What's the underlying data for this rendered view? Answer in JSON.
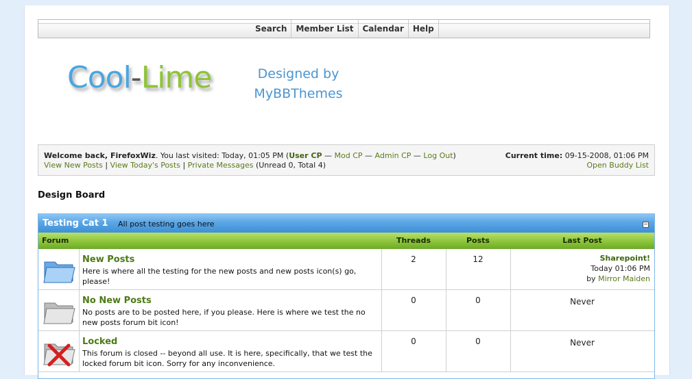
{
  "menu": {
    "items": [
      "Search",
      "Member List",
      "Calendar",
      "Help"
    ]
  },
  "logo": {
    "cool": "Cool",
    "dash": "-",
    "lime": "Lime"
  },
  "designed_by": {
    "line1": "Designed by",
    "line2": "MyBBThemes"
  },
  "welcome": {
    "greeting": "Welcome back, FirefoxWiz",
    "last_visit_prefix": ". You last visited: Today, 01:05 PM (",
    "user_cp": "User CP",
    "sep": " — ",
    "mod_cp": "Mod CP",
    "admin_cp": "Admin CP",
    "log_out": "Log Out",
    "close_paren": ")",
    "current_time_label": "Current time:",
    "current_time_value": " 09-15-2008, 01:06 PM",
    "view_new_posts": "View New Posts",
    "pipe": " | ",
    "view_todays_posts": "View Today's Posts",
    "private_messages": "Private Messages",
    "pm_counts": " (Unread 0, Total 4)",
    "open_buddy_list": "Open Buddy List"
  },
  "board_title": "Design Board",
  "category": {
    "title": "Testing Cat 1",
    "description": "All post testing goes here",
    "collapse": "−"
  },
  "columns": {
    "forum": "Forum",
    "threads": "Threads",
    "posts": "Posts",
    "last_post": "Last Post"
  },
  "forums": [
    {
      "name": "New Posts",
      "description": "Here is where all the testing for the new posts and new posts icon(s) go, please!",
      "threads": "2",
      "posts": "12",
      "last_post_title": "Sharepoint!",
      "last_post_time": "Today 01:06 PM",
      "last_post_by": "by ",
      "last_post_user": "Mirror Maiden",
      "icon": "folder-new-icon"
    },
    {
      "name": "No New Posts",
      "description": "No posts are to be posted here, if you please. Here is where we test the no new posts forum bit icon!",
      "threads": "0",
      "posts": "0",
      "last_post_never": "Never",
      "icon": "folder-old-icon"
    },
    {
      "name": "Locked",
      "description": "This forum is closed -- beyond all use. It is here, specifically, that we test the locked forum bit icon. Sorry for any inconvenience.",
      "threads": "0",
      "posts": "0",
      "last_post_never": "Never",
      "icon": "folder-locked-icon"
    }
  ],
  "colors": {
    "accent_blue": "#4a95d2",
    "lime": "#8ec43a",
    "link_green": "#4c7a14",
    "page_bg": "#e3eefb"
  }
}
